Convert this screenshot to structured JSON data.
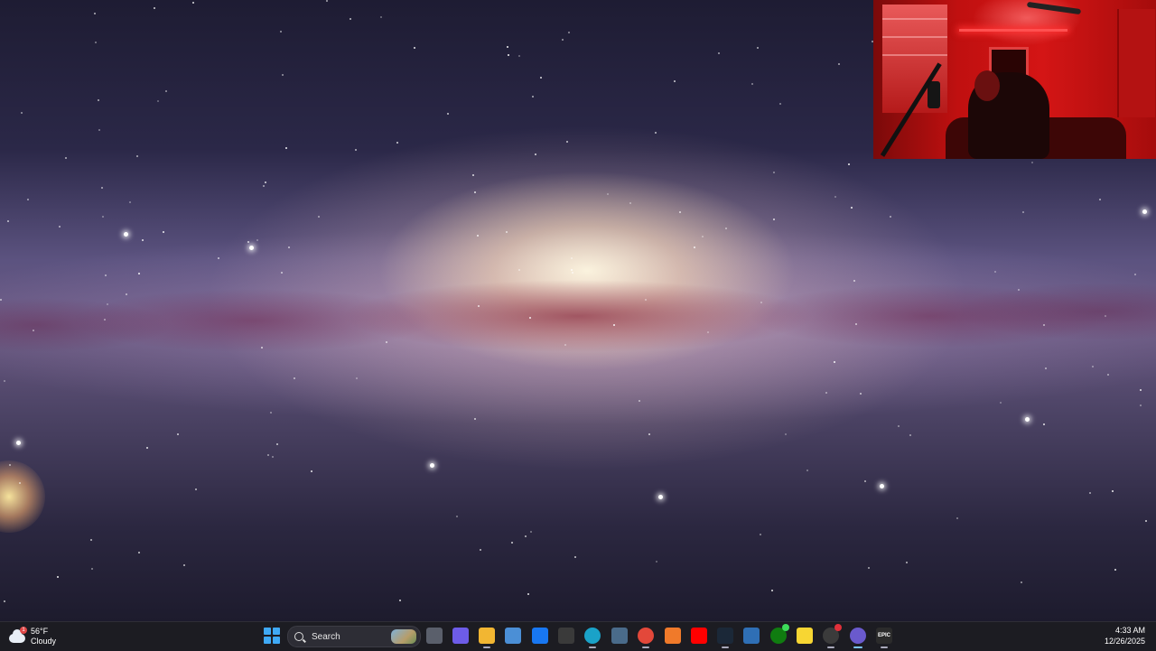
{
  "weather": {
    "temperature": "56°F",
    "condition": "Cloudy",
    "badge": "1",
    "icon": "cloud-icon"
  },
  "search": {
    "placeholder": "Search"
  },
  "taskbar_apps": [
    {
      "name": "task-view-icon",
      "color": "#5a5f6b"
    },
    {
      "name": "copilot-icon",
      "color": "#6d5ce8"
    },
    {
      "name": "file-explorer-icon",
      "color": "#f2b632"
    },
    {
      "name": "microsoft-store-icon",
      "color": "#4b8fd6"
    },
    {
      "name": "facebook-icon",
      "color": "#1877f2"
    },
    {
      "name": "amazon-icon",
      "color": "#3a3a3a"
    },
    {
      "name": "edge-icon",
      "color": "#1aa2c8"
    },
    {
      "name": "calculator-icon",
      "color": "#4a6b8a"
    },
    {
      "name": "chrome-icon",
      "color": "#e3483a"
    },
    {
      "name": "app-a-icon",
      "color": "#f07a2a"
    },
    {
      "name": "youtube-icon",
      "color": "#ff0000"
    },
    {
      "name": "steam-icon",
      "color": "#1b2838"
    },
    {
      "name": "settings-gear-icon",
      "color": "#2f6fb5"
    },
    {
      "name": "xbox-icon",
      "color": "#107c10"
    },
    {
      "name": "sticky-notes-icon",
      "color": "#f7d633"
    },
    {
      "name": "obs-icon",
      "color": "#3b3b3b"
    },
    {
      "name": "cortana-circle-icon",
      "color": "#6a5acd"
    },
    {
      "name": "epic-games-icon",
      "color": "#2b2b2b"
    }
  ],
  "epic_label": "EPIC",
  "clock": {
    "time": "4:33 AM",
    "date": "12/26/2025"
  }
}
